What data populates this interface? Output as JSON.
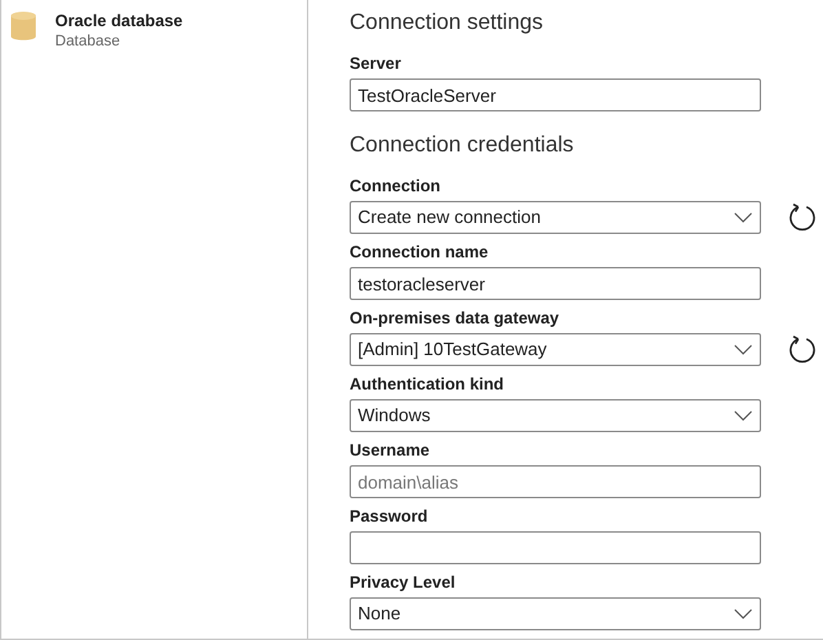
{
  "source": {
    "title": "Oracle database",
    "subtitle": "Database"
  },
  "sections": [
    {
      "title": "Connection settings",
      "fields": [
        {
          "kind": "text",
          "label": "Server",
          "value": "TestOracleServer",
          "refresh": false
        }
      ]
    },
    {
      "title": "Connection credentials",
      "fields": [
        {
          "kind": "dropdown",
          "label": "Connection",
          "value": "Create new connection",
          "refresh": true
        },
        {
          "kind": "text",
          "label": "Connection name",
          "value": "testoracleserver",
          "refresh": false
        },
        {
          "kind": "dropdown",
          "label": "On-premises data gateway",
          "value": "[Admin] 10TestGateway",
          "refresh": true
        },
        {
          "kind": "dropdown",
          "label": "Authentication kind",
          "value": "Windows",
          "refresh": false
        },
        {
          "kind": "text",
          "label": "Username",
          "placeholder": "domain\\alias",
          "refresh": false
        },
        {
          "kind": "text",
          "label": "Password",
          "refresh": false
        },
        {
          "kind": "dropdown",
          "label": "Privacy Level",
          "value": "None",
          "refresh": false
        }
      ]
    }
  ]
}
